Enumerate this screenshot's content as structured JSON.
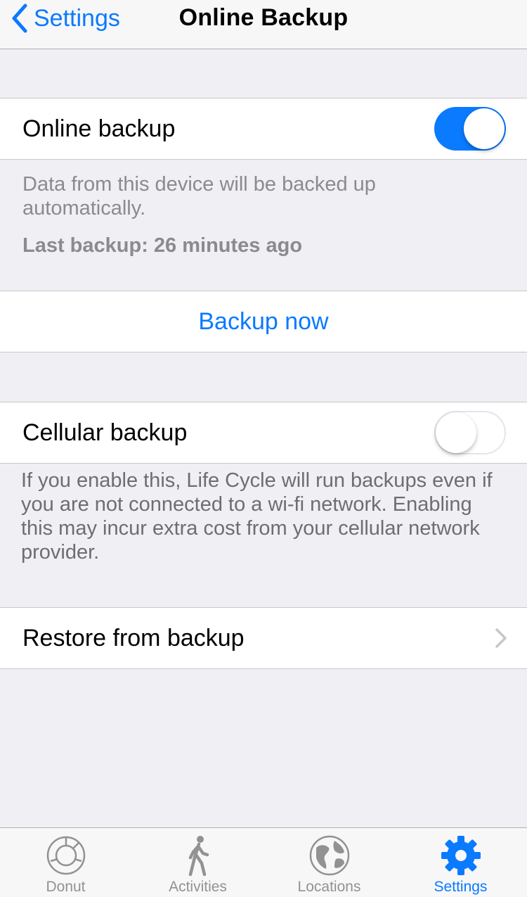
{
  "nav": {
    "back_label": "Settings",
    "title": "Online Backup"
  },
  "online_backup": {
    "label": "Online backup",
    "enabled": true,
    "description": "Data from this device will be backed up automatically.",
    "last_backup": "Last backup: 26 minutes ago"
  },
  "backup_now": {
    "label": "Backup now"
  },
  "cellular_backup": {
    "label": "Cellular backup",
    "enabled": false,
    "description": "If you enable this, Life Cycle will run backups even if you are not connected to a wi-fi network. Enabling this may incur extra cost from your cellular network provider."
  },
  "restore": {
    "label": "Restore from backup"
  },
  "tabs": [
    {
      "label": "Donut",
      "icon": "donut-icon",
      "active": false
    },
    {
      "label": "Activities",
      "icon": "walking-person-icon",
      "active": false
    },
    {
      "label": "Locations",
      "icon": "globe-icon",
      "active": false
    },
    {
      "label": "Settings",
      "icon": "gear-icon",
      "active": true
    }
  ],
  "colors": {
    "accent": "#0a7aff",
    "background": "#efeff4",
    "secondary_text": "#8a8a8f",
    "inactive_tab": "#929292"
  }
}
